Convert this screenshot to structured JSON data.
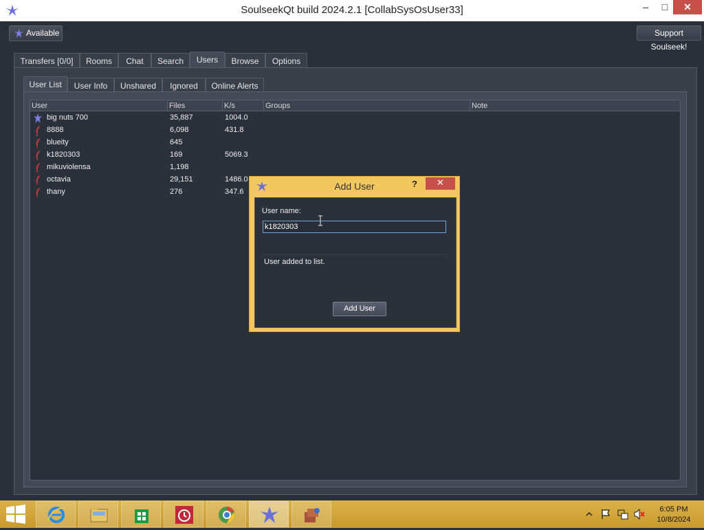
{
  "window": {
    "title": "SoulseekQt build 2024.2.1 [CollabSysOsUser33]",
    "controls": {
      "minimize": "–",
      "maximize": "□",
      "close": "✕"
    }
  },
  "topbar": {
    "status_label": "Available",
    "support_label": "Support Soulseek!"
  },
  "main_tabs": [
    {
      "label": "Transfers [0/0]"
    },
    {
      "label": "Rooms"
    },
    {
      "label": "Chat"
    },
    {
      "label": "Search"
    },
    {
      "label": "Users",
      "active": true
    },
    {
      "label": "Browse"
    },
    {
      "label": "Options"
    }
  ],
  "sub_tabs": [
    {
      "label": "User List",
      "active": true
    },
    {
      "label": "User Info"
    },
    {
      "label": "Unshared"
    },
    {
      "label": "Ignored"
    },
    {
      "label": "Online Alerts"
    }
  ],
  "user_table": {
    "columns": [
      "User",
      "Files",
      "K/s",
      "Groups",
      "Note"
    ],
    "rows": [
      {
        "user": "big nuts 700",
        "files": "35,887",
        "speed": "1004.0",
        "groups": "",
        "note": "",
        "icon": "soulseek-bird-icon"
      },
      {
        "user": "8888",
        "files": "6,098",
        "speed": "431.8",
        "groups": "",
        "note": "",
        "icon": "feather-icon"
      },
      {
        "user": "blueity",
        "files": "645",
        "speed": "",
        "groups": "",
        "note": "",
        "icon": "feather-icon"
      },
      {
        "user": "k1820303",
        "files": "169",
        "speed": "5069.3",
        "groups": "",
        "note": "",
        "icon": "feather-icon"
      },
      {
        "user": "mikuviolensa",
        "files": "1,198",
        "speed": "",
        "groups": "",
        "note": "",
        "icon": "feather-icon"
      },
      {
        "user": "octavia",
        "files": "29,151",
        "speed": "1486.0",
        "groups": "",
        "note": "",
        "icon": "feather-icon"
      },
      {
        "user": "thany",
        "files": "276",
        "speed": "347.6",
        "groups": "",
        "note": "",
        "icon": "feather-icon"
      }
    ]
  },
  "add_user_dialog": {
    "title": "Add User",
    "help": "?",
    "close": "✕",
    "name_label": "User name:",
    "name_value": "k1820303",
    "status_message": "User added to list.",
    "button_label": "Add User"
  },
  "taskbar": {
    "items": [
      "start-icon",
      "internet-explorer-icon",
      "file-explorer-icon",
      "store-icon",
      "alarm-clock-icon",
      "chrome-icon",
      "soulseek-icon",
      "app-box-icon"
    ],
    "clock_time": "6:05 PM",
    "clock_date": "10/8/2024"
  },
  "colors": {
    "window_bg": "#2b2f3a",
    "dialog_frame": "#f3c75f",
    "taskbar": "#d4aa40",
    "close_red": "#c8504a",
    "input_focus": "#6fa4d6"
  }
}
